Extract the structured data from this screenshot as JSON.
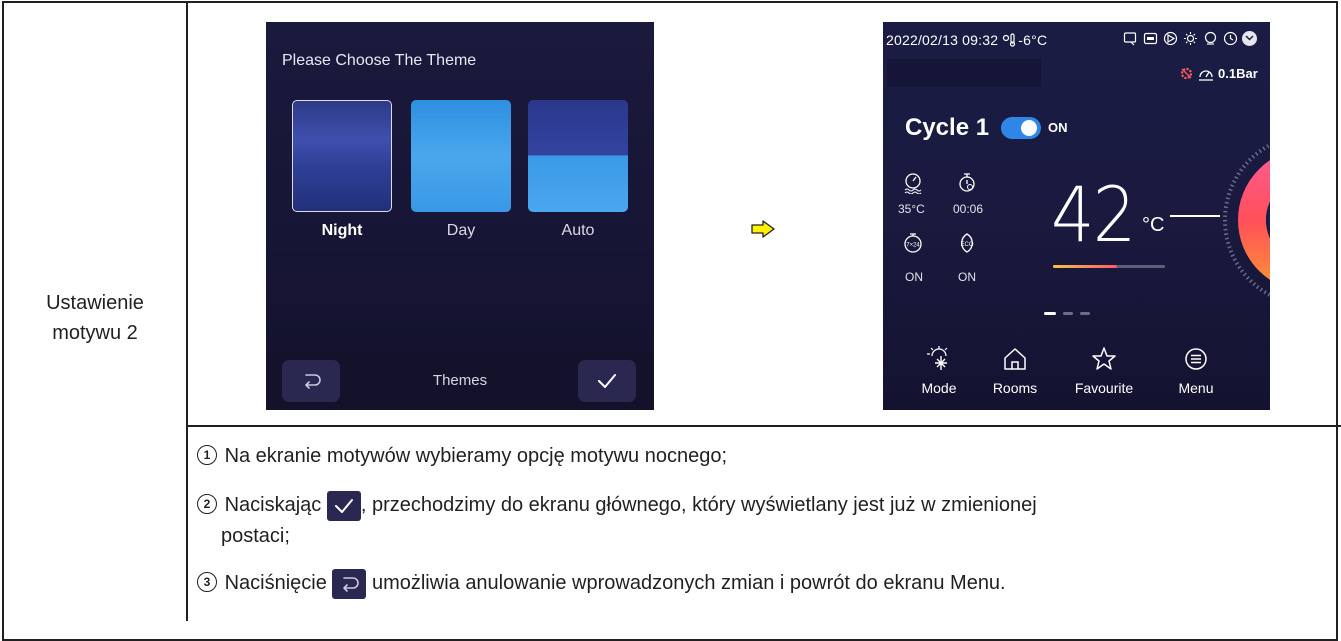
{
  "row_label": "Ustawienie motywu 2",
  "theme_screen": {
    "title": "Please Choose The Theme",
    "options": [
      {
        "label": "Night",
        "selected": true
      },
      {
        "label": "Day",
        "selected": false
      },
      {
        "label": "Auto",
        "selected": false
      }
    ],
    "footer_title": "Themes",
    "back_icon": "back-arrow-icon",
    "confirm_icon": "checkmark-icon"
  },
  "main_screen": {
    "status": "2022/02/13  09:32",
    "outdoor_temp": "-6°C",
    "pressure": "0.1Bar",
    "cycle_title": "Cycle 1",
    "cycle_state": "ON",
    "water_temp": "35°C",
    "timer": "00:06",
    "weekly_state": "ON",
    "eco_state": "ON",
    "set_temp": "42",
    "unit": "°C",
    "nav": [
      {
        "label": "Mode",
        "icon": "snow-sun-icon"
      },
      {
        "label": "Rooms",
        "icon": "home-icon"
      },
      {
        "label": "Favourite",
        "icon": "star-icon"
      },
      {
        "label": "Menu",
        "icon": "menu-list-icon"
      }
    ]
  },
  "steps": [
    {
      "num": "1",
      "text": "Na ekranie motywów wybieramy opcję motywu nocnego;"
    },
    {
      "num": "2",
      "before": "Naciskając",
      "after": ", przechodzimy do ekranu głównego, który wyświetlany jest już w zmienionej",
      "line2": "postaci;"
    },
    {
      "num": "3",
      "before": "Naciśnięcie",
      "after": "umożliwia anulowanie wprowadzonych zmian i powrót do ekranu Menu."
    }
  ],
  "colors": {
    "accent": "#2f86e6",
    "screen_bg": "#1a1a3d",
    "ring_start": "#ff5a8a",
    "ring_end": "#ff8a3a"
  }
}
